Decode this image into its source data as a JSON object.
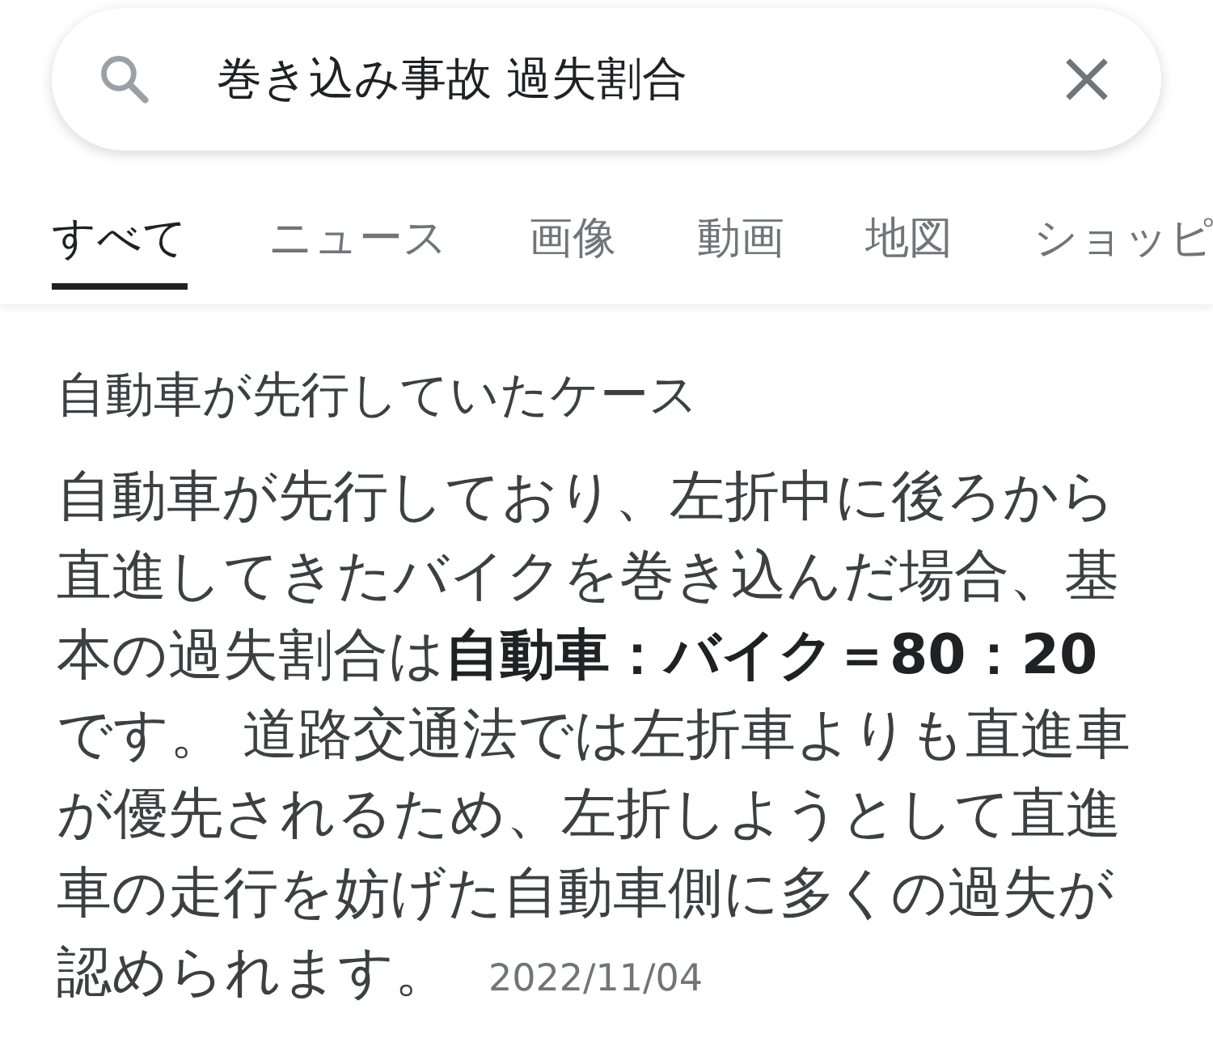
{
  "search": {
    "query": "巻き込み事故 過失割合"
  },
  "tabs": [
    {
      "label": "すべて",
      "selected": true
    },
    {
      "label": "ニュース",
      "selected": false
    },
    {
      "label": "画像",
      "selected": false
    },
    {
      "label": "動画",
      "selected": false
    },
    {
      "label": "地図",
      "selected": false
    },
    {
      "label": "ショッピ",
      "selected": false
    }
  ],
  "result": {
    "title": "自動車が先行していたケース",
    "snippet": "自動車が先行しており、左折中に後ろから直進してきたバイクを巻き込んだ場合、基本の過失割合は**自動車：バイク＝80：20**です。 道路交通法では左折車よりも直進車が優先されるため、左折しようとして直進車の走行を妨げた自動車側に多くの過失が認められます。",
    "date": "2022/11/04"
  }
}
